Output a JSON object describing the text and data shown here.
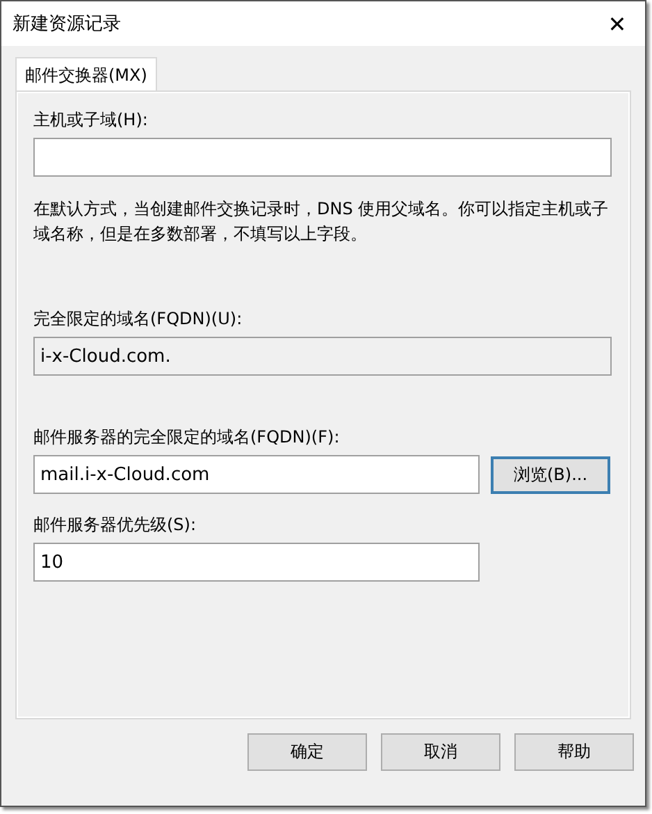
{
  "window": {
    "title": "新建资源记录",
    "close": "✕"
  },
  "tabs": [
    {
      "label": "邮件交换器(MX)",
      "selected": true
    }
  ],
  "sections": [
    {
      "kind": "field",
      "label": "主机或子域(H):"
    },
    {
      "kind": "note",
      "text": "在默认方式，当创建邮件交换记录时，DNS 使用父域名。你可以指定主机或子域名称，但是在多数部署，不填写以上字段。"
    },
    {
      "kind": "readonly",
      "label": "完全限定的域名(FQDN)(U):",
      "value": "i-x-Cloud.com."
    },
    {
      "kind": "short",
      "label": "邮件服务器的完全限定的域名(FQDN)(F):",
      "value": "mail.i-x-Cloud.com",
      "button": "浏览(B)..."
    },
    {
      "kind": "short",
      "label": "邮件服务器优先级(S):",
      "value": "10"
    }
  ],
  "buttons": [
    "确定",
    "取消",
    "帮助"
  ]
}
